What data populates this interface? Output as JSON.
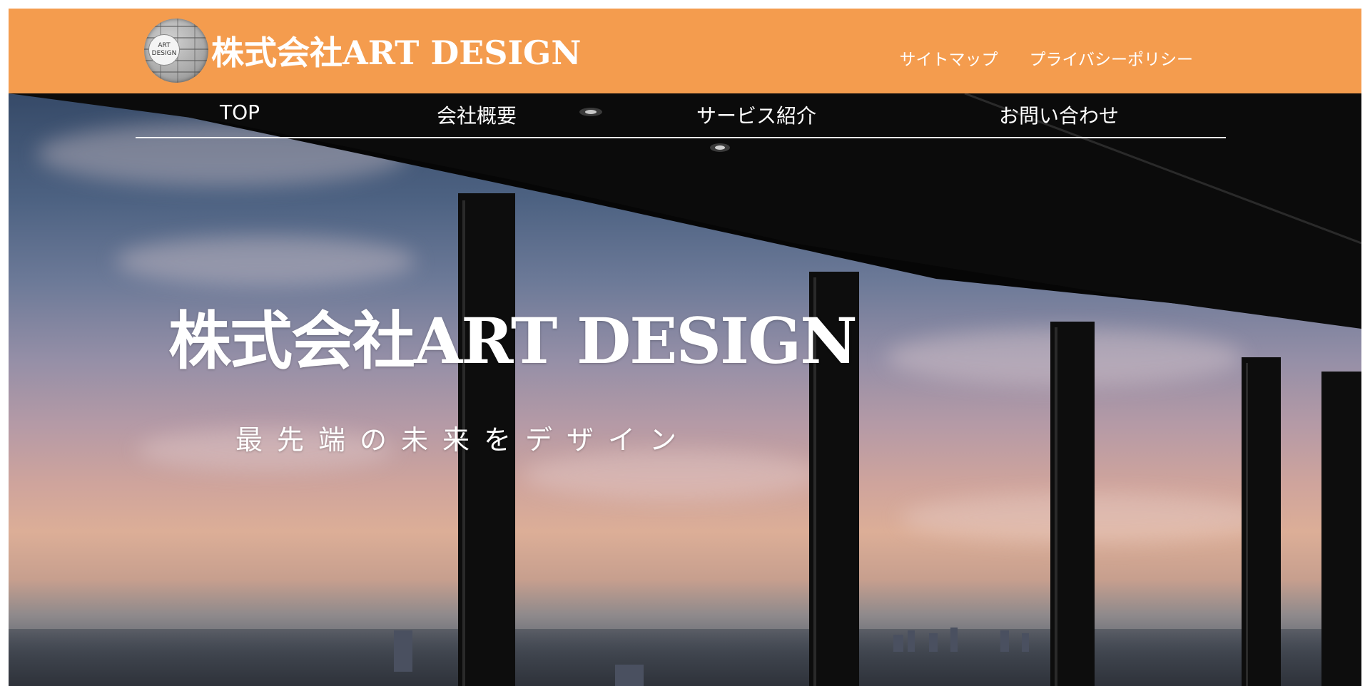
{
  "header": {
    "logo_alt": "ART DESIGN logo",
    "logo_badge_line1": "ART",
    "logo_badge_line2": "DESIGN",
    "company_name": "株式会社ART DESIGN",
    "links": [
      {
        "label": "サイトマップ"
      },
      {
        "label": "プライバシーポリシー"
      }
    ],
    "background_color": "#f49c4e"
  },
  "nav": {
    "items": [
      {
        "label": "TOP"
      },
      {
        "label": "会社概要"
      },
      {
        "label": "サービス紹介"
      },
      {
        "label": "お問い合わせ"
      }
    ]
  },
  "hero": {
    "title": "株式会社ART DESIGN",
    "tagline": "最先端の未来をデザイン"
  }
}
